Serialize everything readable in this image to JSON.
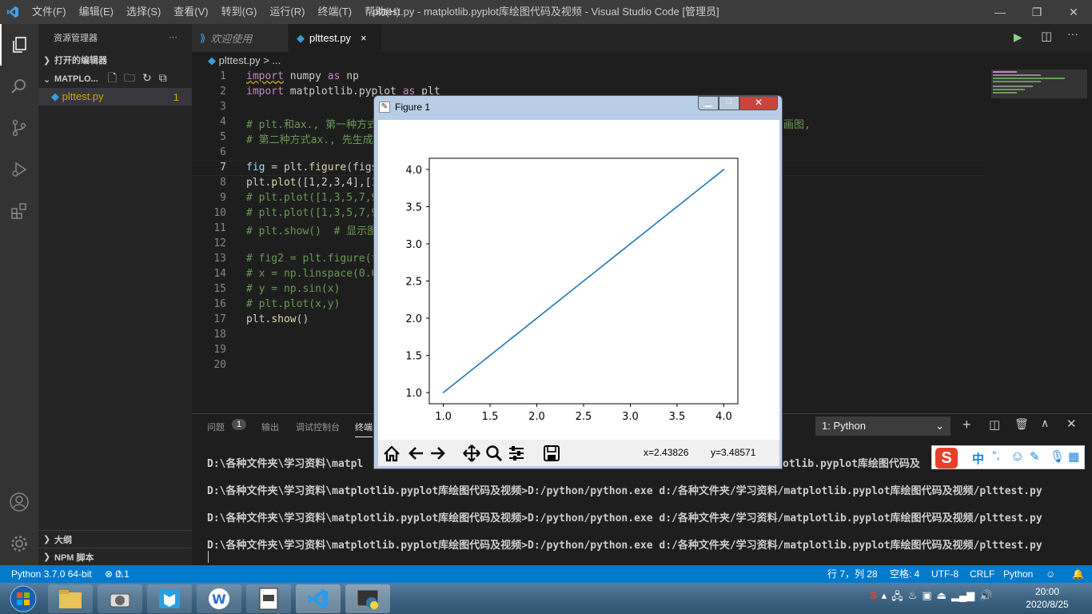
{
  "window": {
    "title": "plttest.py - matplotlib.pyplot库绘图代码及视频 - Visual Studio Code [管理员]",
    "menus": [
      "文件(F)",
      "编辑(E)",
      "选择(S)",
      "查看(V)",
      "转到(G)",
      "运行(R)",
      "终端(T)",
      "帮助(H)"
    ]
  },
  "sidebar": {
    "title": "资源管理器",
    "more": "···",
    "open_editors": "打开的编辑器",
    "folder": "MATPLO...",
    "file": "plttest.py",
    "file_badge": "1",
    "outline": "大纲",
    "npm": "NPM 脚本"
  },
  "tabs": [
    {
      "label": "欢迎使用"
    },
    {
      "label": "plttest.py",
      "close": "×"
    }
  ],
  "breadcrumb": {
    "file": "plttest.py",
    "sep": "> ..."
  },
  "code": [
    {
      "n": "1",
      "t": "import numpy as np"
    },
    {
      "n": "2",
      "t": "import matplotlib.pyplot as plt"
    },
    {
      "n": "3",
      "t": ""
    },
    {
      "n": "4",
      "t": "# plt.和ax., 第一种方式",
      "tail": "画图,"
    },
    {
      "n": "5",
      "t": "# 第二种方式ax., 先生成"
    },
    {
      "n": "6",
      "t": ""
    },
    {
      "n": "7",
      "t": "fig = plt.figure(figs"
    },
    {
      "n": "8",
      "t": "plt.plot([1,2,3,4],[1"
    },
    {
      "n": "9",
      "t": "# plt.plot([1,3,5,7,9"
    },
    {
      "n": "10",
      "t": "# plt.plot([1,3,5,7,9"
    },
    {
      "n": "11",
      "t": "# plt.show()  # 显示图"
    },
    {
      "n": "12",
      "t": ""
    },
    {
      "n": "13",
      "t": "# fig2 = plt.figure(f"
    },
    {
      "n": "14",
      "t": "# x = np.linspace(0.0"
    },
    {
      "n": "15",
      "t": "# y = np.sin(x)"
    },
    {
      "n": "16",
      "t": "# plt.plot(x,y)"
    },
    {
      "n": "17",
      "t": "plt.show()"
    },
    {
      "n": "18",
      "t": ""
    },
    {
      "n": "19",
      "t": ""
    },
    {
      "n": "20",
      "t": ""
    }
  ],
  "panel": {
    "tabs": [
      "问题",
      "输出",
      "调试控制台",
      "终端"
    ],
    "problems_count": "1",
    "terminal_select": "1: Python",
    "lines": [
      "D:\\各种文件夹\\学习资料\\matpl",
      "D:\\各种文件夹\\学习资料\\matplotlib.pyplot库绘图代码及视频>D:/python/python.exe d:/各种文件夹/学习资料/matplotlib.pyplot库绘图代码及视频/plttest.py",
      "D:\\各种文件夹\\学习资料\\matplotlib.pyplot库绘图代码及视频>D:/python/python.exe d:/各种文件夹/学习资料/matplotlib.pyplot库绘图代码及视频/plttest.py",
      "D:\\各种文件夹\\学习资料\\matplotlib.pyplot库绘图代码及视频>D:/python/python.exe d:/各种文件夹/学习资料/matplotlib.pyplot库绘图代码及视频/plttest.py"
    ],
    "line0_tail": "otlib.pyplot库绘图代码及"
  },
  "status": {
    "python": "Python 3.7.0 64-bit",
    "errors": "0",
    "warnings": "1",
    "position": "行 7，列 28",
    "spaces": "空格: 4",
    "encoding": "UTF-8",
    "eol": "CRLF",
    "lang": "Python"
  },
  "figure": {
    "title": "Figure 1",
    "coords_x": "x=2.43826",
    "coords_y": "y=3.48571"
  },
  "chart_data": {
    "type": "line",
    "x": [
      1.0,
      2.0,
      3.0,
      4.0
    ],
    "series": [
      {
        "values": [
          1.0,
          2.0,
          3.0,
          4.0
        ],
        "color": "#1f77b4"
      }
    ],
    "xticks": [
      "1.0",
      "1.5",
      "2.0",
      "2.5",
      "3.0",
      "3.5",
      "4.0"
    ],
    "yticks": [
      "1.0",
      "1.5",
      "2.0",
      "2.5",
      "3.0",
      "3.5",
      "4.0"
    ],
    "xlim": [
      0.85,
      4.15
    ],
    "ylim": [
      0.85,
      4.15
    ],
    "grid": false,
    "title": "",
    "xlabel": "",
    "ylabel": ""
  },
  "ime": {
    "lang": "中"
  },
  "clock": {
    "time": "20:00",
    "date": "2020/8/25"
  },
  "colors": {
    "accent": "#007acc",
    "line": "#1f77b4"
  }
}
